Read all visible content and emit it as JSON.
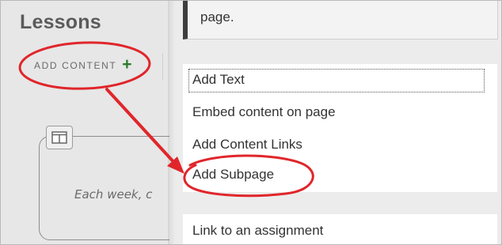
{
  "lessons_title": "Lessons",
  "add_content": {
    "label": "ADD CONTENT",
    "icon": "plus-icon"
  },
  "card": {
    "text": "Each week, c",
    "icon": "layout-columns-icon"
  },
  "callout": {
    "text": "page."
  },
  "menu": {
    "items": [
      {
        "label": "Add Text"
      },
      {
        "label": "Embed content on page"
      },
      {
        "label": "Add Content Links"
      },
      {
        "label": "Add Subpage"
      }
    ],
    "items2": [
      {
        "label": "Link to an assignment"
      }
    ]
  },
  "colors": {
    "annotation": "#e0262b",
    "plus": "#2b7d2b",
    "callout_border": "#3d3d3d"
  }
}
